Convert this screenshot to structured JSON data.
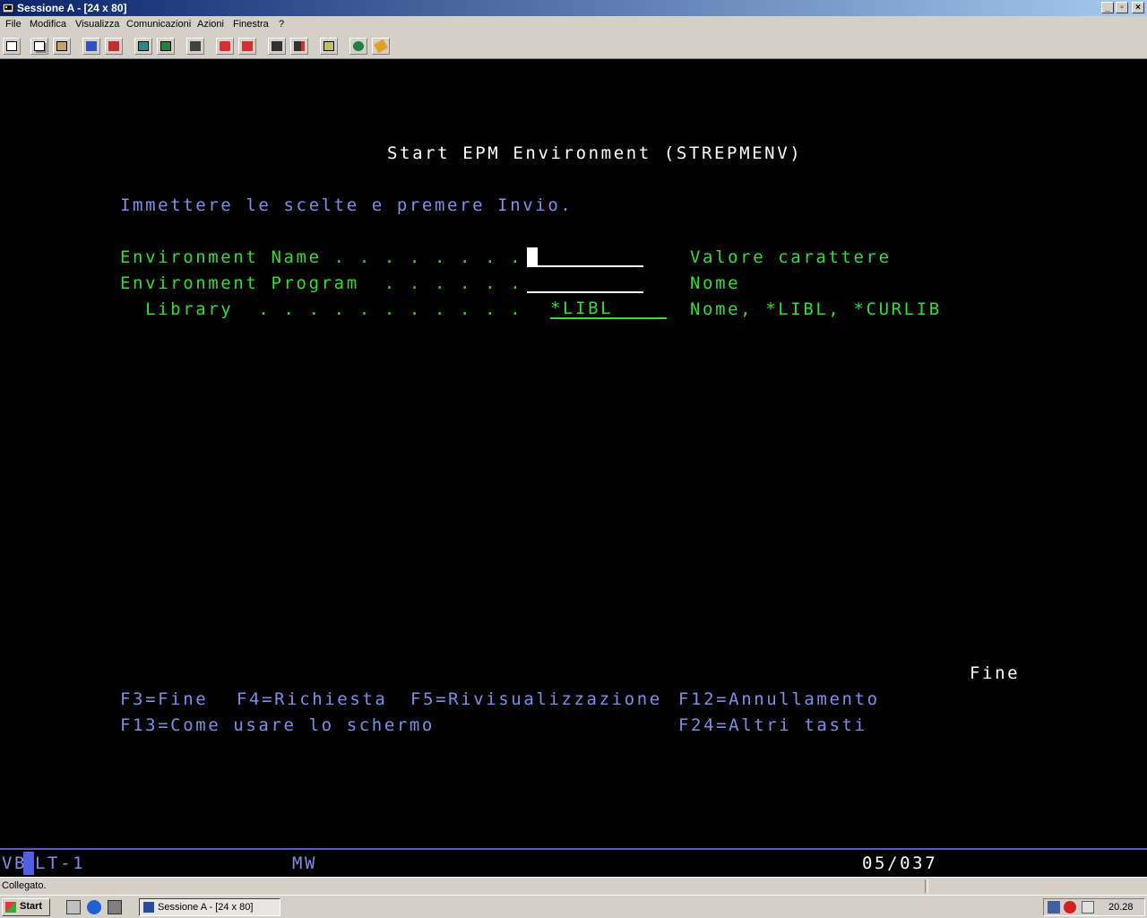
{
  "window": {
    "title": "Sessione A - [24 x 80]",
    "buttons": [
      "minimize",
      "restore",
      "close"
    ]
  },
  "menubar": {
    "items": [
      "File",
      "Modifica",
      "Visualizza",
      "Comunicazioni",
      "Azioni",
      "Finestra",
      "?"
    ]
  },
  "toolbar": {
    "icons": [
      "print-screen-icon",
      "copy-icon",
      "paste-icon",
      "send-file-icon",
      "receive-file-icon",
      "display-icon",
      "keypad-icon",
      "macro-icon",
      "record-icon",
      "play-icon",
      "stop-icon",
      "play-macro-icon",
      "clipboard-icon",
      "globe-icon",
      "customize-icon"
    ]
  },
  "screen": {
    "title": "Start EPM Environment (STREPMENV)",
    "instruction": "Immettere le scelte e premere Invio.",
    "fields": [
      {
        "label": "Environment Name . . . . . . . .",
        "value": "",
        "hint": "Valore carattere"
      },
      {
        "label": "Environment Program  . . . . . .",
        "value": "",
        "hint": "Nome"
      },
      {
        "label": "  Library  . . . . . . . . . . .",
        "value": "*LIBL",
        "hint": "Nome, *LIBL, *CURLIB"
      }
    ],
    "more_indicator": "Fine",
    "fkeys": {
      "f3": "F3=Fine",
      "f4": "F4=Richiesta",
      "f5": "F5=Rivisualizzazione",
      "f12": "F12=Annullamento",
      "f13": "F13=Come usare lo schermo",
      "f24": "F24=Altri tasti"
    }
  },
  "oia": {
    "left_a": "VB",
    "left_b": "LT-1",
    "mode": "MW",
    "cursor_pos": "05/037"
  },
  "statusbar": {
    "message": "Collegato."
  },
  "taskbar": {
    "start_label": "Start",
    "task_label": "Sessione A - [24 x 80]",
    "clock": "20.28"
  }
}
